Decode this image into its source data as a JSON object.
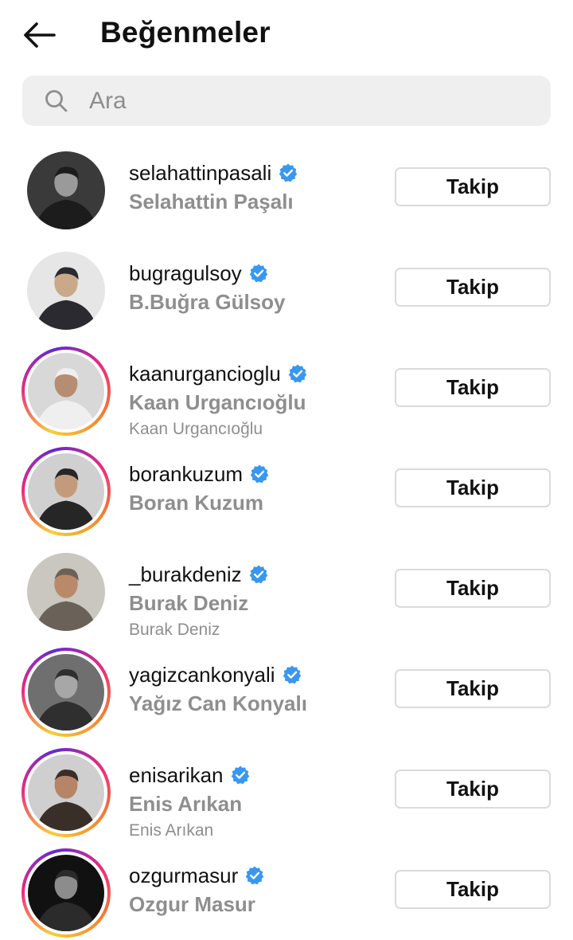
{
  "header": {
    "back_icon": "arrow-left-icon",
    "title": "Beğenmeler"
  },
  "search": {
    "icon": "search-icon",
    "placeholder": "Ara",
    "value": ""
  },
  "users": [
    {
      "username": "selahattinpasali",
      "full_name": "Selahattin Paşalı",
      "sub_name": "",
      "verified": true,
      "story_ring": false,
      "button": "Takip"
    },
    {
      "username": "bugragulsoy",
      "full_name": "B.Buğra Gülsoy",
      "sub_name": "",
      "verified": true,
      "story_ring": false,
      "button": "Takip"
    },
    {
      "username": "kaanurgancioglu",
      "full_name": "Kaan Urgancıoğlu",
      "sub_name": "Kaan Urgancıoğlu",
      "verified": true,
      "story_ring": true,
      "button": "Takip"
    },
    {
      "username": "borankuzum",
      "full_name": "Boran Kuzum",
      "sub_name": "",
      "verified": true,
      "story_ring": true,
      "button": "Takip"
    },
    {
      "username": "_burakdeniz",
      "full_name": "Burak Deniz",
      "sub_name": "Burak Deniz",
      "verified": true,
      "story_ring": false,
      "button": "Takip"
    },
    {
      "username": "yagizcankonyali",
      "full_name": "Yağız Can Konyalı",
      "sub_name": "",
      "verified": true,
      "story_ring": true,
      "button": "Takip"
    },
    {
      "username": "enisarikan",
      "full_name": "Enis Arıkan",
      "sub_name": "Enis Arıkan",
      "verified": true,
      "story_ring": true,
      "button": "Takip"
    },
    {
      "username": "ozgurmasur",
      "full_name": "Ozgur Masur",
      "sub_name": "",
      "verified": true,
      "story_ring": true,
      "button": "Takip"
    }
  ],
  "colors": {
    "verified_badge": "#3897f0",
    "secondary_text": "#8e8e8e",
    "search_bg": "#efefef",
    "button_border": "#dbdbdb"
  }
}
